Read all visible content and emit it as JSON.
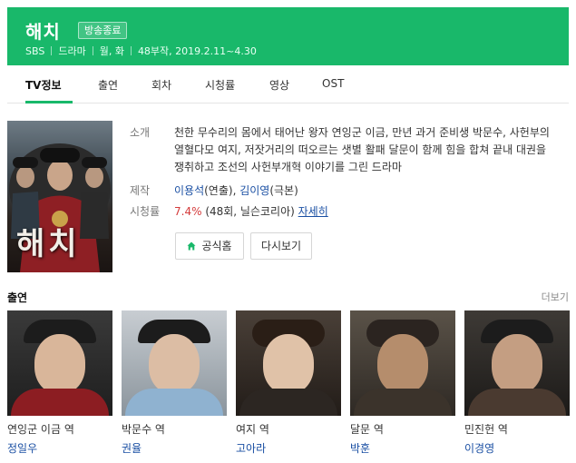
{
  "header": {
    "title": "해치",
    "badge": "방송종료",
    "meta": [
      "SBS",
      "드라마",
      "월, 화",
      "48부작, 2019.2.11~4.30"
    ]
  },
  "tabs": [
    "TV정보",
    "출연",
    "회차",
    "시청률",
    "영상",
    "OST"
  ],
  "poster": {
    "title_text": "해치"
  },
  "info": {
    "desc_label": "소개",
    "description": "천한 무수리의 몸에서 태어난 왕자 연잉군 이금, 만년 과거 준비생 박문수, 사헌부의 열혈다모 여지, 저잣거리의 떠오르는 샛별 활패 달문이 함께 힘을 합쳐 끝내 대권을 쟁취하고 조선의 사헌부개혁 이야기를 그린 드라마",
    "producer_label": "제작",
    "director": "이용석",
    "director_role": "(연출), ",
    "writer": "김이영",
    "writer_role": "(극본)",
    "rating_label": "시청률",
    "rating_value": "7.4%",
    "rating_note": " (48회, 닐슨코리아) ",
    "rating_detail": "자세히"
  },
  "buttons": {
    "homepage": "공식홈",
    "replay": "다시보기"
  },
  "cast": {
    "title": "출연",
    "more": "더보기",
    "items": [
      {
        "role": "연잉군 이금 역",
        "actor": "정일우"
      },
      {
        "role": "박문수 역",
        "actor": "권율"
      },
      {
        "role": "여지 역",
        "actor": "고아라"
      },
      {
        "role": "달문 역",
        "actor": "박훈"
      },
      {
        "role": "민진헌 역",
        "actor": "이경영"
      }
    ]
  },
  "colors": {
    "brand": "#19b86a",
    "link": "#1a4fa3",
    "rating": "#d43b3b"
  }
}
